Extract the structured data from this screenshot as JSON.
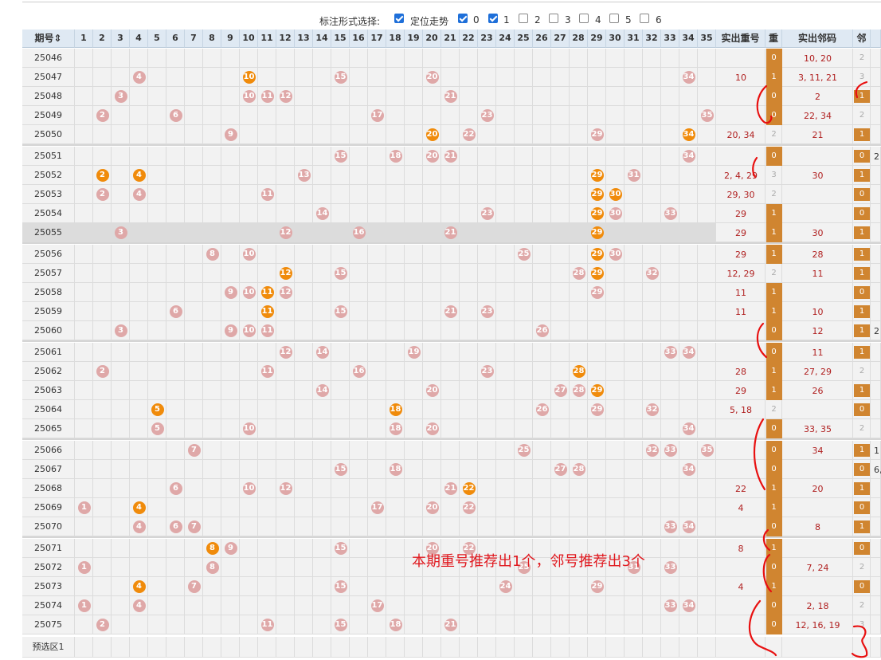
{
  "toolbar": {
    "label": "标注形式选择:",
    "options": [
      {
        "label": "定位走势",
        "checked": true
      },
      {
        "label": "0",
        "checked": true
      },
      {
        "label": "1",
        "checked": true
      },
      {
        "label": "2",
        "checked": false
      },
      {
        "label": "3",
        "checked": false
      },
      {
        "label": "4",
        "checked": false
      },
      {
        "label": "5",
        "checked": false
      },
      {
        "label": "6",
        "checked": false
      }
    ]
  },
  "header": {
    "issue": "期号",
    "sort_icon": "sort-arrows-icon",
    "numbers": [
      "1",
      "2",
      "3",
      "4",
      "5",
      "6",
      "7",
      "8",
      "9",
      "10",
      "11",
      "12",
      "13",
      "14",
      "15",
      "16",
      "17",
      "18",
      "19",
      "20",
      "21",
      "22",
      "23",
      "24",
      "25",
      "26",
      "27",
      "28",
      "29",
      "30",
      "31",
      "32",
      "33",
      "34",
      "35"
    ],
    "repeat_numbers": "实出重号",
    "repeat": "重",
    "neighbor_numbers": "实出邻码",
    "neighbor": "邻"
  },
  "colors": {
    "ball_normal": "#dfa8a8",
    "ball_hit": "#f08b0b",
    "count_box": "#d08530",
    "header_bg": "#dfe9f3",
    "annotation": "#e0181e"
  },
  "rows": [
    {
      "issue": "25046",
      "balls": [],
      "hits": [],
      "repeat_nums": "",
      "repeat": "0",
      "repeat_box": true,
      "neighbor_nums": "10, 20",
      "neighbor": "2",
      "neighbor_box": false
    },
    {
      "issue": "25047",
      "balls": [
        4,
        10,
        15,
        20,
        34
      ],
      "hits": [
        10
      ],
      "repeat_nums": "10",
      "repeat": "1",
      "repeat_box": true,
      "neighbor_nums": "3, 11, 21",
      "neighbor": "3",
      "neighbor_box": false
    },
    {
      "issue": "25048",
      "balls": [
        3,
        10,
        11,
        12,
        21
      ],
      "hits": [],
      "repeat_nums": "",
      "repeat": "0",
      "repeat_box": true,
      "neighbor_nums": "2",
      "neighbor": "1",
      "neighbor_box": true
    },
    {
      "issue": "25049",
      "balls": [
        2,
        6,
        17,
        23,
        35
      ],
      "hits": [],
      "repeat_nums": "",
      "repeat": "0",
      "repeat_box": true,
      "neighbor_nums": "22, 34",
      "neighbor": "2",
      "neighbor_box": false
    },
    {
      "issue": "25050",
      "balls": [
        9,
        20,
        22,
        29,
        34
      ],
      "hits": [
        20,
        34
      ],
      "repeat_nums": "20, 34",
      "repeat": "2",
      "repeat_box": false,
      "neighbor_nums": "21",
      "neighbor": "1",
      "neighbor_box": true
    },
    {
      "issue": "25051",
      "balls": [
        15,
        18,
        20,
        21,
        34
      ],
      "hits": [],
      "repeat_nums": "",
      "repeat": "0",
      "repeat_box": true,
      "neighbor_nums": "",
      "neighbor": "0",
      "neighbor_box": true
    },
    {
      "issue": "25052",
      "balls": [
        2,
        4,
        13,
        29,
        31
      ],
      "hits": [
        2,
        4,
        29
      ],
      "repeat_nums": "2, 4, 29",
      "repeat": "3",
      "repeat_box": false,
      "neighbor_nums": "30",
      "neighbor": "1",
      "neighbor_box": true
    },
    {
      "issue": "25053",
      "balls": [
        2,
        4,
        11,
        29,
        30
      ],
      "hits": [
        29,
        30
      ],
      "repeat_nums": "29, 30",
      "repeat": "2",
      "repeat_box": false,
      "neighbor_nums": "",
      "neighbor": "0",
      "neighbor_box": true
    },
    {
      "issue": "25054",
      "balls": [
        14,
        23,
        29,
        30,
        33
      ],
      "hits": [
        29
      ],
      "repeat_nums": "29",
      "repeat": "1",
      "repeat_box": true,
      "neighbor_nums": "",
      "neighbor": "0",
      "neighbor_box": true
    },
    {
      "issue": "25055",
      "balls": [
        3,
        12,
        16,
        21,
        29
      ],
      "hits": [
        29
      ],
      "repeat_nums": "29",
      "repeat": "1",
      "repeat_box": true,
      "neighbor_nums": "30",
      "neighbor": "1",
      "neighbor_box": true
    },
    {
      "issue": "25056",
      "balls": [
        8,
        10,
        25,
        29,
        30
      ],
      "hits": [
        29
      ],
      "repeat_nums": "29",
      "repeat": "1",
      "repeat_box": true,
      "neighbor_nums": "28",
      "neighbor": "1",
      "neighbor_box": true
    },
    {
      "issue": "25057",
      "balls": [
        12,
        15,
        28,
        29,
        32
      ],
      "hits": [
        12,
        29
      ],
      "repeat_nums": "12, 29",
      "repeat": "2",
      "repeat_box": false,
      "neighbor_nums": "11",
      "neighbor": "1",
      "neighbor_box": true
    },
    {
      "issue": "25058",
      "balls": [
        9,
        10,
        11,
        12,
        29
      ],
      "hits": [
        11
      ],
      "repeat_nums": "11",
      "repeat": "1",
      "repeat_box": true,
      "neighbor_nums": "",
      "neighbor": "0",
      "neighbor_box": true
    },
    {
      "issue": "25059",
      "balls": [
        6,
        11,
        15,
        21,
        23
      ],
      "hits": [
        11
      ],
      "repeat_nums": "11",
      "repeat": "1",
      "repeat_box": true,
      "neighbor_nums": "10",
      "neighbor": "1",
      "neighbor_box": true
    },
    {
      "issue": "25060",
      "balls": [
        3,
        9,
        10,
        11,
        26
      ],
      "hits": [],
      "repeat_nums": "",
      "repeat": "0",
      "repeat_box": true,
      "neighbor_nums": "12",
      "neighbor": "1",
      "neighbor_box": true
    },
    {
      "issue": "25061",
      "balls": [
        12,
        14,
        19,
        33,
        34
      ],
      "hits": [],
      "repeat_nums": "",
      "repeat": "0",
      "repeat_box": true,
      "neighbor_nums": "11",
      "neighbor": "1",
      "neighbor_box": true
    },
    {
      "issue": "25062",
      "balls": [
        2,
        11,
        16,
        23,
        28
      ],
      "hits": [
        28
      ],
      "repeat_nums": "28",
      "repeat": "1",
      "repeat_box": true,
      "neighbor_nums": "27, 29",
      "neighbor": "2",
      "neighbor_box": false
    },
    {
      "issue": "25063",
      "balls": [
        14,
        20,
        27,
        28,
        29
      ],
      "hits": [
        29
      ],
      "repeat_nums": "29",
      "repeat": "1",
      "repeat_box": true,
      "neighbor_nums": "26",
      "neighbor": "1",
      "neighbor_box": true
    },
    {
      "issue": "25064",
      "balls": [
        5,
        18,
        26,
        29,
        32
      ],
      "hits": [
        5,
        18
      ],
      "repeat_nums": "5, 18",
      "repeat": "2",
      "repeat_box": false,
      "neighbor_nums": "",
      "neighbor": "0",
      "neighbor_box": true
    },
    {
      "issue": "25065",
      "balls": [
        5,
        10,
        18,
        20,
        34
      ],
      "hits": [],
      "repeat_nums": "",
      "repeat": "0",
      "repeat_box": true,
      "neighbor_nums": "33, 35",
      "neighbor": "2",
      "neighbor_box": false
    },
    {
      "issue": "25066",
      "balls": [
        7,
        25,
        32,
        33,
        35
      ],
      "hits": [],
      "repeat_nums": "",
      "repeat": "0",
      "repeat_box": true,
      "neighbor_nums": "34",
      "neighbor": "1",
      "neighbor_box": true
    },
    {
      "issue": "25067",
      "balls": [
        15,
        18,
        27,
        28,
        34
      ],
      "hits": [],
      "repeat_nums": "",
      "repeat": "0",
      "repeat_box": true,
      "neighbor_nums": "",
      "neighbor": "0",
      "neighbor_box": true
    },
    {
      "issue": "25068",
      "balls": [
        6,
        10,
        12,
        21,
        22
      ],
      "hits": [
        22
      ],
      "repeat_nums": "22",
      "repeat": "1",
      "repeat_box": true,
      "neighbor_nums": "20",
      "neighbor": "1",
      "neighbor_box": true
    },
    {
      "issue": "25069",
      "balls": [
        1,
        4,
        17,
        20,
        22
      ],
      "hits": [
        4
      ],
      "repeat_nums": "4",
      "repeat": "1",
      "repeat_box": true,
      "neighbor_nums": "",
      "neighbor": "0",
      "neighbor_box": true
    },
    {
      "issue": "25070",
      "balls": [
        4,
        6,
        7,
        33,
        34
      ],
      "hits": [],
      "repeat_nums": "",
      "repeat": "0",
      "repeat_box": true,
      "neighbor_nums": "8",
      "neighbor": "1",
      "neighbor_box": true
    },
    {
      "issue": "25071",
      "balls": [
        8,
        9,
        15,
        20,
        22
      ],
      "hits": [
        8
      ],
      "repeat_nums": "8",
      "repeat": "1",
      "repeat_box": true,
      "neighbor_nums": "",
      "neighbor": "0",
      "neighbor_box": true
    },
    {
      "issue": "25072",
      "balls": [
        1,
        8,
        25,
        31,
        33
      ],
      "hits": [],
      "repeat_nums": "",
      "repeat": "0",
      "repeat_box": true,
      "neighbor_nums": "7, 24",
      "neighbor": "2",
      "neighbor_box": false
    },
    {
      "issue": "25073",
      "balls": [
        4,
        7,
        15,
        24,
        29
      ],
      "hits": [
        4
      ],
      "repeat_nums": "4",
      "repeat": "1",
      "repeat_box": true,
      "neighbor_nums": "",
      "neighbor": "0",
      "neighbor_box": true
    },
    {
      "issue": "25074",
      "balls": [
        1,
        4,
        17,
        33,
        34
      ],
      "hits": [],
      "repeat_nums": "",
      "repeat": "0",
      "repeat_box": true,
      "neighbor_nums": "2, 18",
      "neighbor": "2",
      "neighbor_box": false
    },
    {
      "issue": "25075",
      "balls": [
        2,
        11,
        15,
        18,
        21
      ],
      "hits": [],
      "repeat_nums": "",
      "repeat": "0",
      "repeat_box": true,
      "neighbor_nums": "12, 16, 19",
      "neighbor": "3",
      "neighbor_box": false
    }
  ],
  "partial_right": {
    "r25051": "2",
    "r25060": "2",
    "r25066": "1",
    "r25067": "6,"
  },
  "preselect": "预选区1",
  "annotation": "本期重号推荐出1个，邻号推荐出3个"
}
